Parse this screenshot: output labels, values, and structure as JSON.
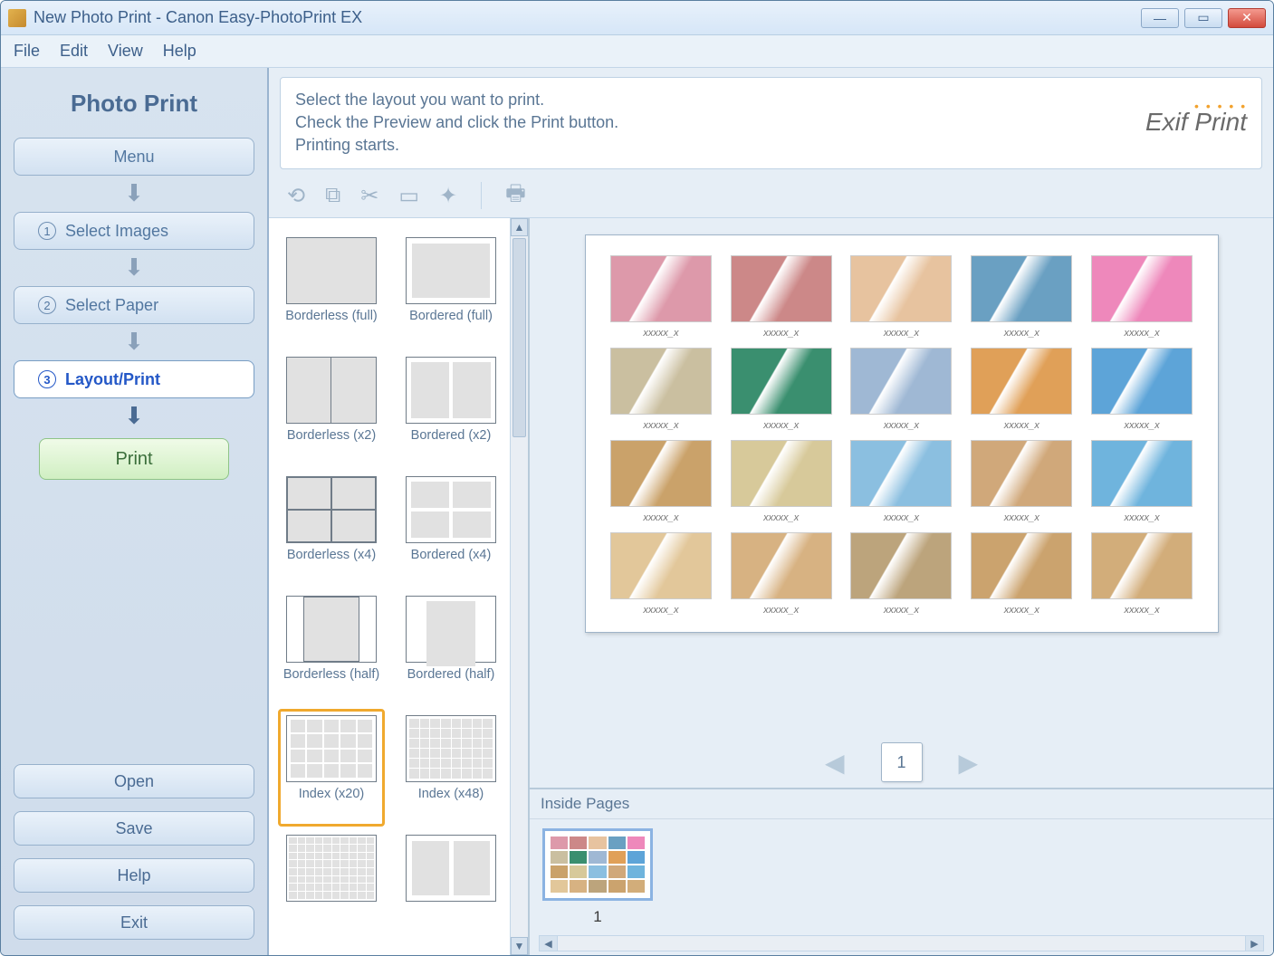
{
  "window": {
    "title": "New Photo Print - Canon Easy-PhotoPrint EX"
  },
  "menubar": {
    "file": "File",
    "edit": "Edit",
    "view": "View",
    "help": "Help"
  },
  "sidebar": {
    "title": "Photo Print",
    "menu": "Menu",
    "step1": "Select Images",
    "step2": "Select Paper",
    "step3": "Layout/Print",
    "print": "Print",
    "open": "Open",
    "save": "Save",
    "help": "Help",
    "exit": "Exit",
    "n1": "1",
    "n2": "2",
    "n3": "3"
  },
  "instructions": {
    "line1": "Select the layout you want to print.",
    "line2": "Check the Preview and click the Print button.",
    "line3": "Printing starts."
  },
  "exif": "Exif Print",
  "layouts": {
    "borderless_full": "Borderless (full)",
    "bordered_full": "Bordered (full)",
    "borderless_x2": "Borderless (x2)",
    "bordered_x2": "Bordered (x2)",
    "borderless_x4": "Borderless (x4)",
    "bordered_x4": "Bordered (x4)",
    "borderless_half": "Borderless (half)",
    "bordered_half": "Bordered (half)",
    "index_x20": "Index (x20)",
    "index_x48": "Index (x48)",
    "selected": "index_x20"
  },
  "pager": {
    "current": "1"
  },
  "inside": {
    "header": "Inside Pages",
    "page_label": "1"
  },
  "photo_caption": "xxxxx_x"
}
